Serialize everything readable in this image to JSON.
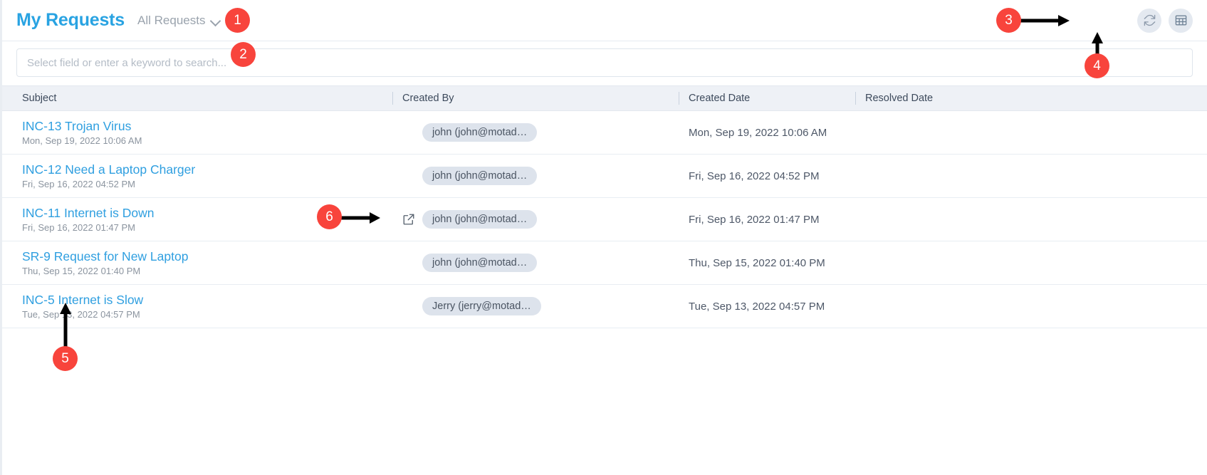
{
  "header": {
    "title": "My Requests",
    "filter_label": "All Requests",
    "chevron_icon": "chevron-down-icon",
    "refresh_icon": "refresh-icon",
    "grid_icon": "grid-view-icon"
  },
  "search": {
    "placeholder": "Select field or enter a keyword to search...",
    "value": ""
  },
  "table": {
    "columns": [
      {
        "label": "Subject"
      },
      {
        "label": "Created By"
      },
      {
        "label": "Created Date"
      },
      {
        "label": "Resolved Date"
      }
    ],
    "rows": [
      {
        "subject": "INC-13 Trojan Virus",
        "subject_sub": "Mon, Sep 19, 2022 10:06 AM",
        "created_by": "john (john@motad…",
        "created_date": "Mon, Sep 19, 2022 10:06 AM",
        "resolved_date": "",
        "show_external_icon": false
      },
      {
        "subject": "INC-12 Need a Laptop Charger",
        "subject_sub": "Fri, Sep 16, 2022 04:52 PM",
        "created_by": "john (john@motad…",
        "created_date": "Fri, Sep 16, 2022 04:52 PM",
        "resolved_date": "",
        "show_external_icon": false
      },
      {
        "subject": "INC-11 Internet is Down",
        "subject_sub": "Fri, Sep 16, 2022 01:47 PM",
        "created_by": "john (john@motad…",
        "created_date": "Fri, Sep 16, 2022 01:47 PM",
        "resolved_date": "",
        "show_external_icon": true
      },
      {
        "subject": "SR-9 Request for New Laptop",
        "subject_sub": "Thu, Sep 15, 2022 01:40 PM",
        "created_by": "john (john@motad…",
        "created_date": "Thu, Sep 15, 2022 01:40 PM",
        "resolved_date": "",
        "show_external_icon": false
      },
      {
        "subject": "INC-5 Internet is Slow",
        "subject_sub": "Tue, Sep 13, 2022 04:57 PM",
        "created_by": "Jerry (jerry@motad…",
        "created_date": "Tue, Sep 13, 2022 04:57 PM",
        "resolved_date": "",
        "show_external_icon": false
      }
    ]
  },
  "annotations": [
    {
      "label": "1"
    },
    {
      "label": "2"
    },
    {
      "label": "3"
    },
    {
      "label": "4"
    },
    {
      "label": "5"
    },
    {
      "label": "6"
    }
  ],
  "colors": {
    "accent": "#29a3e2",
    "link": "#2f9fe0",
    "annotation": "#f8443c",
    "header_bg": "#eef1f6",
    "chip_bg": "#dde3ec"
  }
}
